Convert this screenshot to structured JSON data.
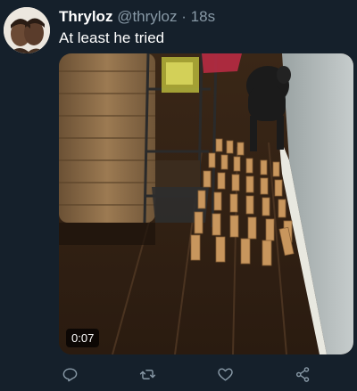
{
  "tweet": {
    "display_name": "Thryloz",
    "handle": "@thryloz",
    "separator": "·",
    "time": "18s",
    "text": "At least he tried"
  },
  "media": {
    "type": "video",
    "duration": "0:07"
  },
  "actions": [
    {
      "name": "reply",
      "icon": "reply-icon"
    },
    {
      "name": "retweet",
      "icon": "retweet-icon"
    },
    {
      "name": "like",
      "icon": "heart-icon"
    },
    {
      "name": "share",
      "icon": "share-icon"
    }
  ],
  "colors": {
    "background": "#15202b",
    "secondary_text": "#8899a6",
    "primary_text": "#ffffff"
  }
}
